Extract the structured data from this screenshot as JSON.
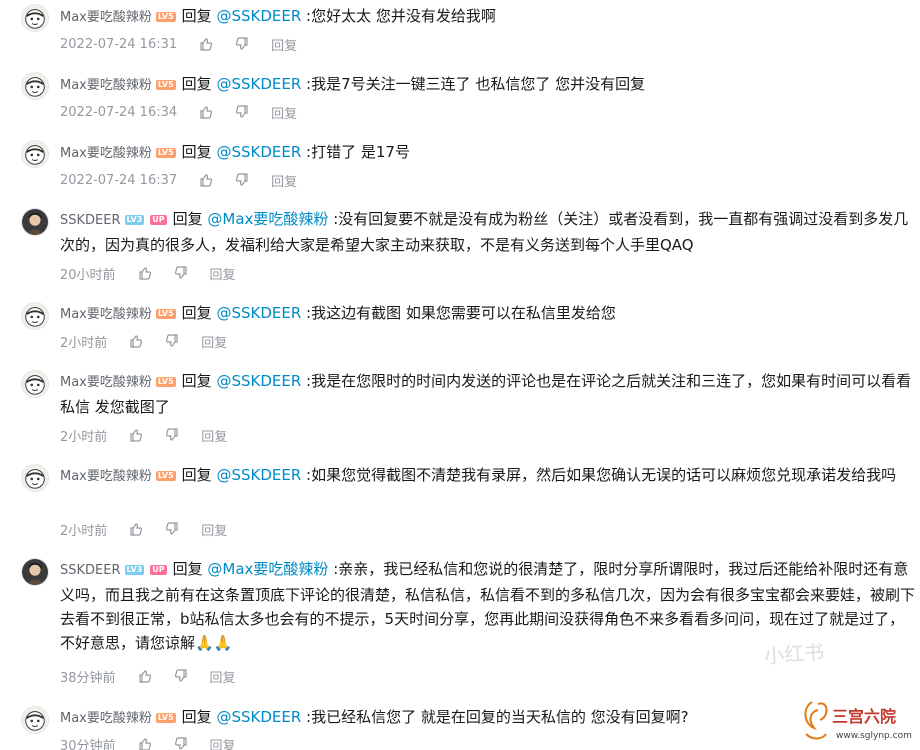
{
  "comments": [
    {
      "user": "Max要吃酸辣粉",
      "level": "LV5",
      "avatar": "ninja-avatar",
      "verb": "回复",
      "at": "@SSKDEER",
      "text": ":您好太太 您并没有发给我啊",
      "time": "2022-07-24 16:31",
      "reply_label": "回复"
    },
    {
      "user": "Max要吃酸辣粉",
      "level": "LV5",
      "avatar": "ninja-avatar",
      "verb": "回复",
      "at": "@SSKDEER",
      "text": ":我是7号关注一键三连了   也私信您了 您并没有回复",
      "time": "2022-07-24 16:34",
      "reply_label": "回复"
    },
    {
      "user": "Max要吃酸辣粉",
      "level": "LV5",
      "avatar": "ninja-avatar",
      "verb": "回复",
      "at": "@SSKDEER",
      "text": ":打错了   是17号",
      "time": "2022-07-24 16:37",
      "reply_label": "回复"
    },
    {
      "user": "SSKDEER",
      "level": "LV3",
      "up": "UP",
      "avatar": "portrait-avatar",
      "verb": "回复",
      "at": "@Max要吃酸辣粉",
      "text": ":没有回复要不就是没有成为粉丝（关注）或者没看到，我一直都有强调过没看到多发几次的，因为真的很多人，发福利给大家是希望大家主动来获取，不是有义务送到每个人手里QAQ",
      "time": "20小时前",
      "reply_label": "回复"
    },
    {
      "user": "Max要吃酸辣粉",
      "level": "LV5",
      "avatar": "ninja-avatar",
      "verb": "回复",
      "at": "@SSKDEER",
      "text": ":我这边有截图 如果您需要可以在私信里发给您",
      "time": "2小时前",
      "reply_label": "回复"
    },
    {
      "user": "Max要吃酸辣粉",
      "level": "LV5",
      "avatar": "ninja-avatar",
      "verb": "回复",
      "at": "@SSKDEER",
      "text": ":我是在您限时的时间内发送的评论也是在评论之后就关注和三连了，您如果有时间可以看看私信 发您截图了",
      "time": "2小时前",
      "reply_label": "回复"
    },
    {
      "user": "Max要吃酸辣粉",
      "level": "LV5",
      "avatar": "ninja-avatar",
      "verb": "回复",
      "at": "@SSKDEER",
      "text": ":如果您觉得截图不清楚我有录屏，然后如果您确认无误的话可以麻烦您兑现承诺发给我吗",
      "time": "2小时前",
      "reply_label": "回复"
    },
    {
      "user": "SSKDEER",
      "level": "LV3",
      "up": "UP",
      "avatar": "portrait-avatar",
      "verb": "回复",
      "at": "@Max要吃酸辣粉",
      "text": ":亲亲，我已经私信和您说的很清楚了，限时分享所谓限时，我过后还能给补限时还有意义吗，而且我之前有在这条置顶底下评论的很清楚，私信私信，私信看不到的多私信几次，因为会有很多宝宝都会来要娃，被刷下去看不到很正常，b站私信太多也会有的不提示，5天时间分享，您再此期间没获得角色不来多看看多问问，现在过了就是过了，不好意思，请您谅解🙏🙏",
      "time": "38分钟前",
      "reply_label": "回复"
    },
    {
      "user": "Max要吃酸辣粉",
      "level": "LV5",
      "avatar": "ninja-avatar",
      "verb": "回复",
      "at": "@SSKDEER",
      "text": ":我已经私信您了 就是在回复的当天私信的 您没有回复啊?",
      "time": "30分钟前",
      "reply_label": "回复"
    }
  ],
  "watermarks": {
    "xhs": "小红书",
    "site_name": "三宫六院",
    "site_url": "www.sglynp.com"
  },
  "icons": {
    "like": "thumb-up-icon",
    "dislike": "thumb-down-icon"
  },
  "colors": {
    "link": "#008ac5",
    "meta": "#9499a0",
    "lv5": "#ff9f6b",
    "lv3": "#7bcdef",
    "up": "#fb7299"
  }
}
